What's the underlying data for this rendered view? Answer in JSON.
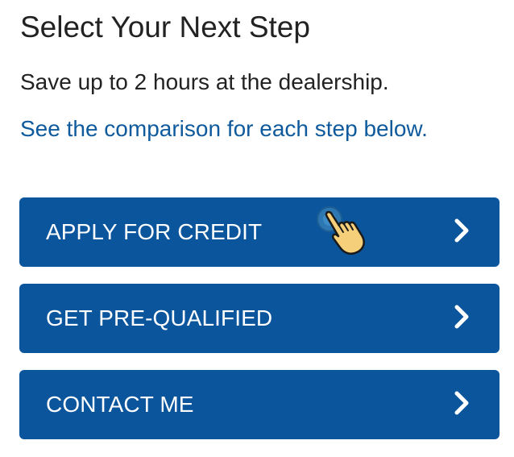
{
  "header": {
    "title": "Select Your Next Step",
    "subtitle": "Save up to 2 hours at the dealership.",
    "comparison_link": "See the comparison for each step below."
  },
  "steps": [
    {
      "label": "APPLY FOR CREDIT",
      "icon": "chevron-right-icon"
    },
    {
      "label": "GET PRE-QUALIFIED",
      "icon": "chevron-right-icon"
    },
    {
      "label": "CONTACT ME",
      "icon": "chevron-right-icon"
    }
  ],
  "cursor": {
    "icon": "hand-pointer-icon"
  },
  "colors": {
    "button_bg": "#0b559d",
    "link": "#0f5a9c",
    "text": "#222222",
    "button_text": "#ffffff"
  }
}
